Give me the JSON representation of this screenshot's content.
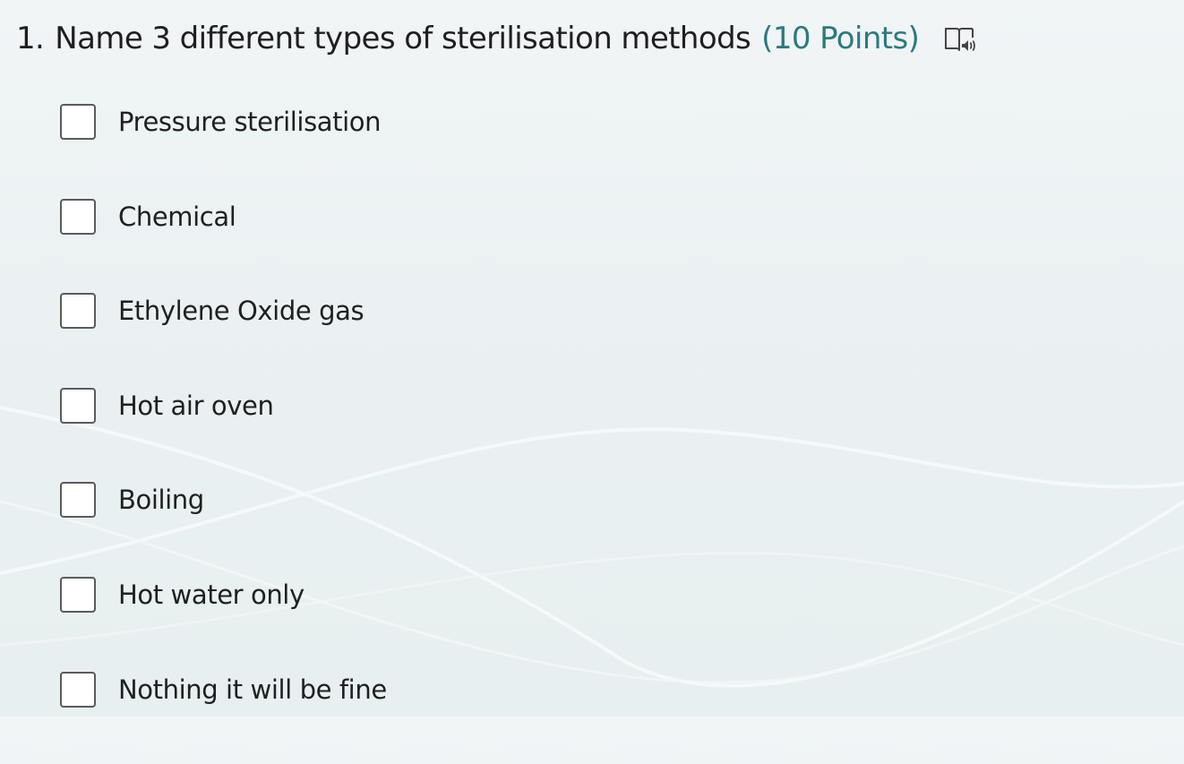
{
  "question": {
    "number": "1.",
    "title": "Name 3 different types of sterilisation methods",
    "points": "(10 Points)",
    "reader_icon": "immersive-reader-icon"
  },
  "options": [
    {
      "label": "Pressure sterilisation",
      "checked": false
    },
    {
      "label": "Chemical",
      "checked": false
    },
    {
      "label": "Ethylene Oxide gas",
      "checked": false
    },
    {
      "label": "Hot air oven",
      "checked": false
    },
    {
      "label": "Boiling",
      "checked": false
    },
    {
      "label": "Hot water only",
      "checked": false
    },
    {
      "label": "Nothing it will be fine",
      "checked": false
    }
  ],
  "colors": {
    "accent": "#2c7a7f",
    "text": "#1f1f1f",
    "checkbox_border": "#5b5b5b"
  }
}
